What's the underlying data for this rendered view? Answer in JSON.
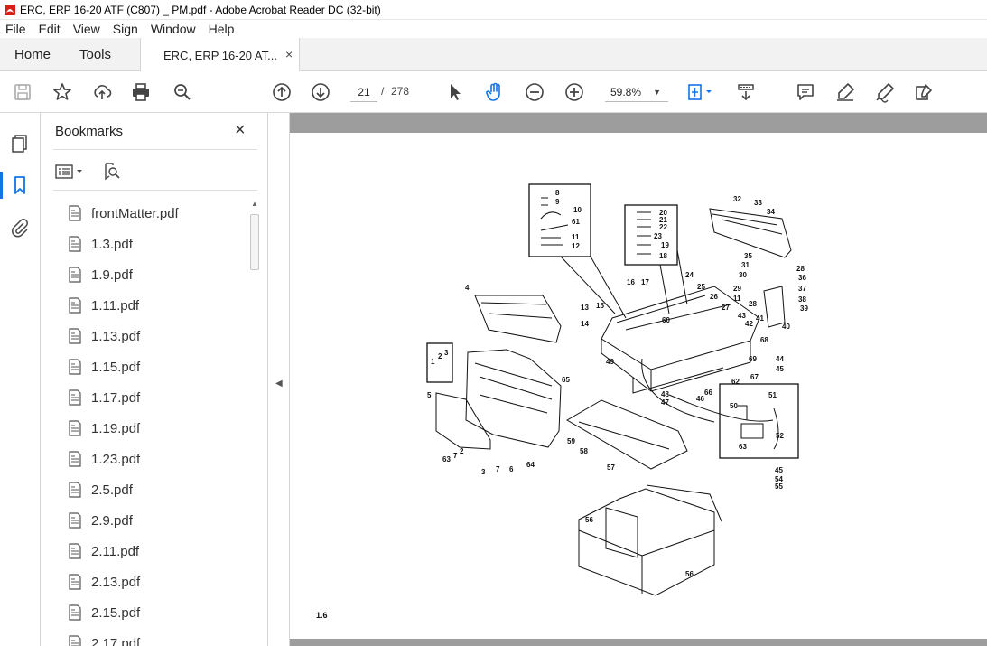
{
  "window": {
    "title": "ERC, ERP 16-20 ATF (C807) _ PM.pdf - Adobe Acrobat Reader DC (32-bit)"
  },
  "menu": [
    "File",
    "Edit",
    "View",
    "Sign",
    "Window",
    "Help"
  ],
  "tabs": {
    "home": "Home",
    "tools": "Tools",
    "document": "ERC, ERP 16-20 AT...",
    "close": "×"
  },
  "toolbar": {
    "page_current": "21",
    "page_separator": "/",
    "page_total": "278",
    "zoom": "59.8%"
  },
  "bookmarks": {
    "title": "Bookmarks",
    "close": "×",
    "items": [
      "frontMatter.pdf",
      "1.3.pdf",
      "1.9.pdf",
      "1.11.pdf",
      "1.13.pdf",
      "1.15.pdf",
      "1.17.pdf",
      "1.19.pdf",
      "1.23.pdf",
      "2.5.pdf",
      "2.9.pdf",
      "2.11.pdf",
      "2.13.pdf",
      "2.15.pdf",
      "2.17.pdf"
    ]
  },
  "document": {
    "page_label": "1.6",
    "callouts": [
      "8",
      "9",
      "10",
      "61",
      "11",
      "12",
      "20",
      "21",
      "22",
      "23",
      "19",
      "18",
      "32",
      "33",
      "34",
      "35",
      "31",
      "30",
      "28",
      "36",
      "29",
      "11",
      "28",
      "37",
      "38",
      "39",
      "43",
      "41",
      "42",
      "40",
      "24",
      "16",
      "17",
      "25",
      "26",
      "13",
      "15",
      "14",
      "60",
      "27",
      "4",
      "1",
      "2",
      "3",
      "65",
      "5",
      "49",
      "68",
      "69",
      "44",
      "45",
      "67",
      "62",
      "66",
      "48",
      "47",
      "46",
      "50",
      "51",
      "52",
      "63",
      "59",
      "64",
      "58",
      "57",
      "7",
      "2",
      "63",
      "3",
      "7",
      "6",
      "45",
      "54",
      "55",
      "56",
      "56"
    ]
  },
  "icons": {
    "toolbar": [
      "save-icon",
      "bookmark-star-icon",
      "upload-icon",
      "print-icon",
      "zoom-search-icon",
      "page-up-icon",
      "page-down-icon",
      "select-pointer-icon",
      "hand-icon",
      "zoom-out-icon",
      "zoom-in-icon",
      "fit-page-icon",
      "scroll-mode-icon",
      "comment-icon",
      "highlight-icon",
      "sign-icon",
      "fill-sign-icon"
    ],
    "accent": "#1473e6"
  }
}
